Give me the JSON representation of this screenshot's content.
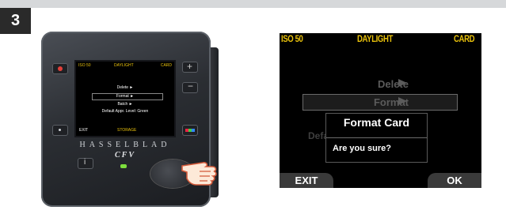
{
  "step": "3",
  "camera": {
    "brand": "HASSELBLAD",
    "model": "CFV",
    "screen": {
      "iso": "ISO 50",
      "wb": "DAYLIGHT",
      "storage": "CARD",
      "menu": [
        "Delete ►",
        "Format ►",
        "Batch ►",
        "Default Appr. Level: Green"
      ],
      "bottom_left": "EXIT",
      "bottom_mid": "STORAGE"
    }
  },
  "display": {
    "iso": "ISO 50",
    "wb": "DAYLIGHT",
    "storage": "CARD",
    "menu_delete": "Delete",
    "menu_format": "Format",
    "partial_default": "Defa",
    "dialog_title": "Format Card",
    "dialog_text": "Are you sure?",
    "exit": "EXIT",
    "ok": "OK"
  }
}
